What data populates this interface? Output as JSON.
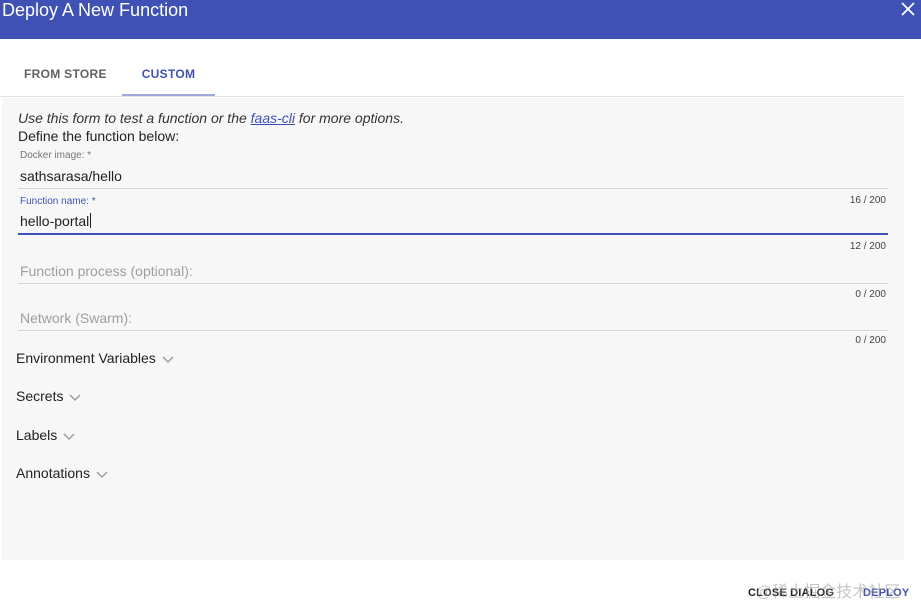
{
  "dialog": {
    "title": "Deploy A New Function",
    "colors": {
      "header": "#3f51b5",
      "accent": "#3f51b5"
    }
  },
  "tabs": [
    {
      "label": "FROM STORE",
      "active": false
    },
    {
      "label": "CUSTOM",
      "active": true
    }
  ],
  "form": {
    "intro_prefix": "Use this form to test a function or the ",
    "intro_link": "faas-cli",
    "intro_suffix": " for more options.",
    "define_text": "Define the function below:",
    "fields": {
      "docker_image": {
        "label": "Docker image: *",
        "value": "sathsarasa/hello",
        "counter": "16 / 200"
      },
      "function_name": {
        "label": "Function name: *",
        "value": "hello-portal",
        "counter": "12 / 200"
      },
      "function_process": {
        "placeholder": "Function process (optional):",
        "counter": "0 / 200"
      },
      "network": {
        "placeholder": "Network (Swarm):",
        "counter": "0 / 200"
      }
    },
    "sections": [
      "Environment Variables",
      "Secrets",
      "Labels",
      "Annotations"
    ]
  },
  "actions": {
    "close_label": "CLOSE DIALOG",
    "deploy_label": "DEPLOY"
  },
  "watermark": "@稀土掘金技术社区",
  "icons": {
    "close": "close-icon",
    "expand": "chevron-down-icon"
  }
}
